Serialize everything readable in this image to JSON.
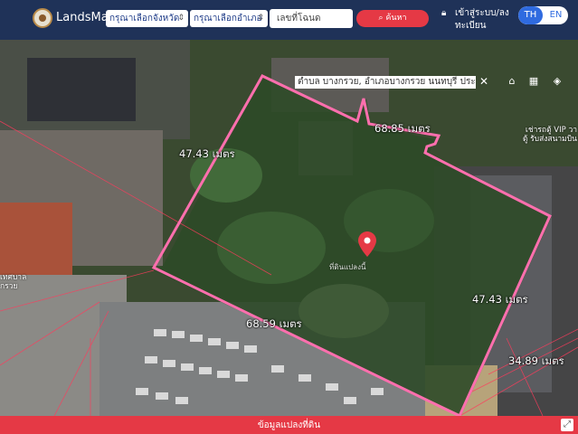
{
  "header": {
    "brand": "LandsMaps",
    "province_placeholder": "กรุณาเลือกจังหวัด",
    "district_placeholder": "กรุณาเลือกอำเภอ",
    "parcel_placeholder": "เลขที่โฉนด",
    "search_label": "ค้นหา",
    "login_label": "เข้าสู่ระบบ/ลงทะเบียน",
    "lang_th": "TH",
    "lang_en": "EN"
  },
  "map": {
    "address": "ตำบล บางกรวย, อำเภอบางกรวย นนทบุรี ประเทศไทย",
    "dimensions": {
      "top": "68.85 เมตร",
      "left": "47.43 เมตร",
      "right": "47.43 เมตร",
      "bottom": "68.59 เมตร",
      "neighbor": "34.89 เมตร"
    },
    "neighbor_labels": {
      "right_line1": "เช่ารถตู้ VIP วา",
      "right_line2": "ตู้ รับส่งสนามบิน",
      "left_line1": "เทศบาล",
      "left_line2": "กรวย"
    },
    "parcel_name": "ที่ดินแปลงนี้",
    "parcel_color": "#ff5fa2",
    "pin_color": "#e53945"
  },
  "bottom_bar": {
    "label": "ข้อมูลแปลงที่ดิน",
    "color": "#e53945"
  }
}
